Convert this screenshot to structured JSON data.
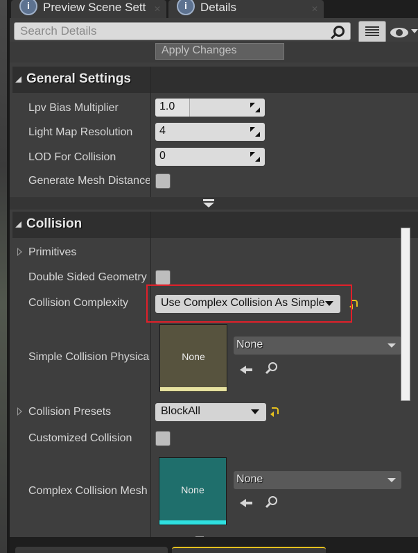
{
  "tabs": [
    {
      "label": "Preview Scene Sett",
      "icon": "info-icon"
    },
    {
      "label": "Details",
      "icon": "info-icon"
    }
  ],
  "search": {
    "placeholder": "Search Details"
  },
  "apply_changes": "Apply Changes",
  "categories": {
    "general": {
      "title": "General Settings",
      "rows": [
        {
          "label": "Lpv Bias Multiplier",
          "value": "1.0"
        },
        {
          "label": "Light Map Resolution",
          "value": "4"
        },
        {
          "label": "LOD For Collision",
          "value": "0"
        },
        {
          "label": "Generate Mesh Distance",
          "checked": false
        }
      ]
    },
    "collision": {
      "title": "Collision",
      "primitives": "Primitives",
      "double_sided": {
        "label": "Double Sided Geometry",
        "checked": false
      },
      "complexity": {
        "label": "Collision Complexity",
        "value": "Use Complex Collision As Simple"
      },
      "simple_physical": {
        "label": "Simple Collision Physica",
        "thumb": "None",
        "asset": "None"
      },
      "presets": {
        "label": "Collision Presets",
        "value": "BlockAll"
      },
      "customized": {
        "label": "Customized Collision",
        "checked": false
      },
      "complex_mesh": {
        "label": "Complex Collision Mesh",
        "thumb": "None",
        "asset": "None"
      }
    }
  },
  "colors": {
    "highlight": "#e0202a",
    "physmat_thumb": "#57533e",
    "physmat_bar": "#e8e3a0",
    "mesh_thumb": "#1f6f6c",
    "mesh_bar": "#2fe0e0",
    "reset_arrow": "#e6c11e"
  }
}
